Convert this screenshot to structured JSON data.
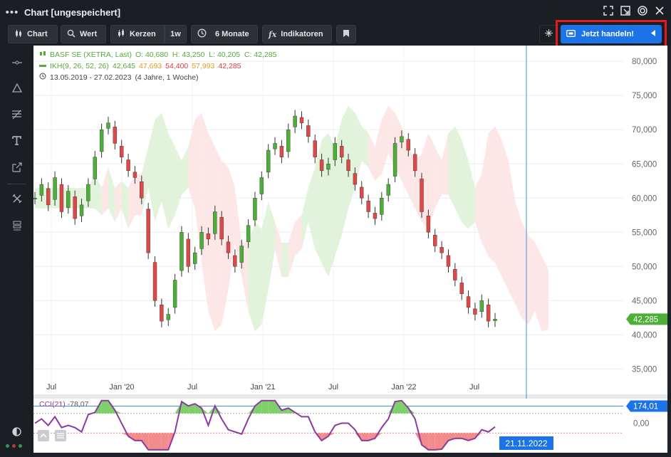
{
  "window": {
    "title": "Chart [ungespeichert]",
    "menu_icon": "more-dots-icon",
    "controls": [
      "fullscreen-icon",
      "undock-icon",
      "target-icon",
      "close-icon"
    ]
  },
  "toolbar": {
    "chart_label": "Chart",
    "wert_label": "Wert",
    "kerzen_label": "Kerzen",
    "interval_label": "1w",
    "range_label": "6 Monate",
    "indicators_label": "Indikatoren",
    "trade_label": "Jetzt handeln!"
  },
  "legend": {
    "instrument": "BASF SE (XETRA, Last)",
    "ohlc": "O: 40,680  H: 43,250  L: 40,205  C: 42,285",
    "ikh_label": "IKH(9, 26, 52, 26)",
    "ikh_values": [
      "42,645",
      "47,693",
      "54,400",
      "57,993",
      "42,285"
    ],
    "period": "13.05.2019 - 27.02.2023",
    "period_note": "(4 Jahre, 1 Woche)"
  },
  "cci": {
    "label": "CCI(21)",
    "value": "-78,07",
    "tag_value": "174,01",
    "axis_label": "0,00"
  },
  "crosshair_date": "21.11.2022",
  "last_price_tag": "42,285",
  "colors": {
    "up": "#4caf37",
    "down": "#e04848",
    "cloud_up": "#dff2d7",
    "cloud_down": "#fde3e3",
    "cci_line": "#8a3aa0",
    "accent": "#1c73e8"
  },
  "chart_data": {
    "type": "candlestick",
    "y_ticks": [
      "80,000",
      "75,000",
      "70,000",
      "65,000",
      "60,000",
      "55,000",
      "50,000",
      "45,000",
      "40,000",
      "35,000"
    ],
    "x_ticks": [
      "Jul",
      "Jan '20",
      "Jul",
      "Jan '21",
      "Jul",
      "Jan '22",
      "Jul"
    ],
    "ylim": [
      31.5,
      82
    ],
    "close_path": [
      60,
      62,
      59,
      63,
      58,
      61,
      57,
      59,
      62,
      66,
      70,
      71,
      68,
      66,
      64,
      63,
      60,
      52,
      45,
      42,
      43,
      48,
      55,
      50,
      52,
      55,
      54,
      58,
      54,
      52,
      50,
      53,
      56,
      60,
      63,
      67,
      68,
      66,
      70,
      72,
      71,
      69,
      66,
      64,
      65,
      68,
      66,
      64,
      62,
      60,
      58,
      57,
      60,
      62,
      68,
      69,
      67,
      64,
      58,
      55,
      53,
      52,
      50,
      48,
      46,
      44,
      43,
      45,
      42,
      42.3
    ],
    "cci_range": [
      -300,
      250
    ]
  }
}
